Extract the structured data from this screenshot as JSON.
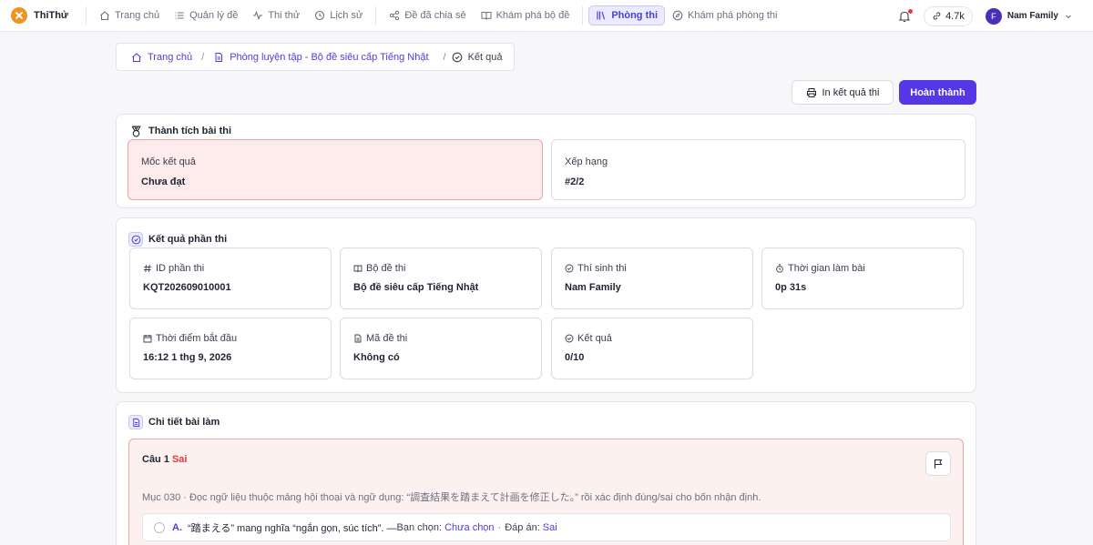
{
  "app": {
    "name": "ThiThử"
  },
  "nav": [
    {
      "label": "Trang chủ",
      "icon": "home-icon"
    },
    {
      "label": "Quản lý đề",
      "icon": "list-icon"
    },
    {
      "label": "Thi thử",
      "icon": "activity-icon"
    },
    {
      "label": "Lịch sử",
      "icon": "history-icon"
    },
    {
      "label": "Đề đã chia sẻ",
      "icon": "share-icon"
    },
    {
      "label": "Khám phá bộ đề",
      "icon": "book-open-icon"
    },
    {
      "label": "Phòng thi",
      "icon": "library-icon",
      "active": true
    },
    {
      "label": "Khám phá phòng thi",
      "icon": "compass-icon"
    }
  ],
  "topright": {
    "stat": "4.7k",
    "user_initial": "F",
    "user_name": "Nam Family"
  },
  "breadcrumb": {
    "home": "Trang chủ",
    "room": "Phòng luyện tập - Bộ đề siêu cấp Tiếng Nhật",
    "current": "Kết quả",
    "separator": "/"
  },
  "actions": {
    "print": "In kết quả thi",
    "done": "Hoàn thành"
  },
  "achievement": {
    "title": "Thành tích bài thi",
    "milestone_label": "Mốc kết quả",
    "milestone_value": "Chưa đạt",
    "rank_label": "Xếp hạng",
    "rank_value": "#2/2"
  },
  "result": {
    "title": "Kết quả phần thi",
    "cards": [
      {
        "label": "ID phần thi",
        "value": "KQT202609010001",
        "icon": "hash-icon"
      },
      {
        "label": "Bộ đề thi",
        "value": "Bộ đề siêu cấp Tiếng Nhật",
        "icon": "book-icon"
      },
      {
        "label": "Thí sinh thi",
        "value": "Nam Family",
        "icon": "check-circle-icon"
      },
      {
        "label": "Thời gian làm bài",
        "value": "0p 31s",
        "icon": "timer-icon"
      },
      {
        "label": "Thời điểm bắt đầu",
        "value": "16:12 1 thg 9, 2026",
        "icon": "calendar-clock-icon"
      },
      {
        "label": "Mã đề thi",
        "value": "Không có",
        "icon": "file-icon"
      },
      {
        "label": "Kết quả",
        "value": "0/10",
        "icon": "check-circle-icon"
      }
    ]
  },
  "detail": {
    "title": "Chi tiết bài làm",
    "question": {
      "number": "Câu 1",
      "status": "Sai",
      "text": "Mục 030 · Đọc ngữ liệu thuộc mảng hội thoại và ngữ dụng: “調査結果を踏まえて計画を修正した。” rồi xác định đúng/sai cho bốn nhận định.",
      "option": {
        "letter": "A.",
        "text": "“踏まえる” mang nghĩa “ngắn gọn, súc tích”. — ",
        "chosen_label": "Bạn chọn:",
        "chosen": "Chưa chọn",
        "dot": "·",
        "answer_label": "Đáp án:",
        "answer": "Sai"
      }
    }
  },
  "colors": {
    "accent": "#5537e6",
    "fail_bg": "#fdeceb",
    "fail_border": "#f1a4a1",
    "error": "#e5383b"
  }
}
